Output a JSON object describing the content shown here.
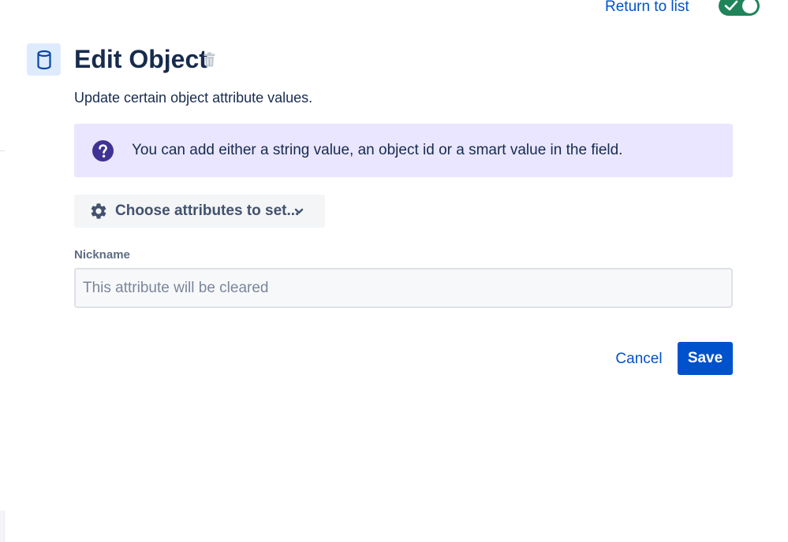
{
  "header": {
    "return_link": "Return to list",
    "toggle_state": "on",
    "title": "Edit Object",
    "description": "Update certain object attribute values."
  },
  "icons": {
    "object": "database-icon",
    "delete": "trash-icon",
    "help": "question-circle-icon",
    "settings": "gear-icon",
    "dropdown": "chevron-down-icon",
    "toggle_check": "check-icon"
  },
  "banner": {
    "message": "You can add either a string value, an object id or a smart value in the field."
  },
  "attributes_button": {
    "label": "Choose attributes to set..."
  },
  "fields": [
    {
      "label": "Nickname",
      "value": "",
      "placeholder": "This attribute will be cleared"
    }
  ],
  "actions": {
    "cancel": "Cancel",
    "save": "Save"
  },
  "colors": {
    "primary": "#0052cc",
    "toggle_on": "#1f845a",
    "banner_bg": "#eae6ff",
    "help_icon": "#403294"
  }
}
